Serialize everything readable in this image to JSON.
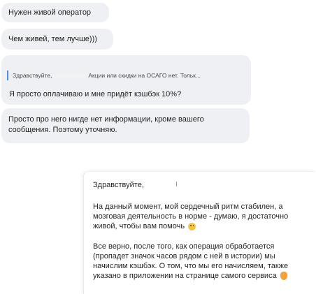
{
  "chat": {
    "messages": [
      {
        "text": "Нужен живой оператор"
      },
      {
        "text": "Чем живей, тем лучше)))"
      },
      {
        "quote": {
          "greeting": "Здравствуйте,",
          "text": "Акции или скидки на ОСАГО нет. Тольк..."
        },
        "text": "Я просто оплачиваю и мне придёт кэшбэк 10%?"
      },
      {
        "text": "Просто про него нигде нет информации, кроме вашего сообщения. Поэтому уточняю."
      }
    ],
    "reply": {
      "greeting": "Здравствуйте,",
      "paragraph1": "На данный момент, мой сердечный ритм стабилен, а мозговая деятельность в норме - думаю, я достаточно живой, чтобы вам помочь",
      "paragraph1_emoji": "smiling-face-icon",
      "paragraph2": "Все верно, после того, как операция обработается (пропадет значок часов рядом с ней в истории) мы начислим кэшбэк. О том, что мы его начисляем, также указано в приложении на странице самого сервиса",
      "paragraph2_emoji": "hand-icon"
    }
  }
}
